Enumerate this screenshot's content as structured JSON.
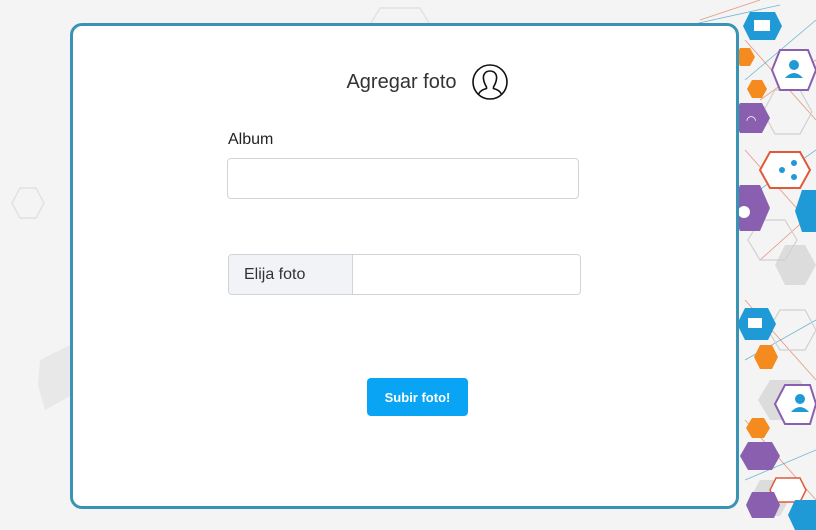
{
  "form": {
    "title": "Agregar foto",
    "album_label": "Album",
    "album_value": "",
    "file_button_label": "Elija foto",
    "file_name": "",
    "submit_label": "Subir foto!"
  },
  "icons": {
    "title_icon": "user-profile-icon"
  },
  "colors": {
    "card_border": "#3b93b3",
    "submit_button": "#0aa4f4",
    "file_button_bg": "#f1f3f6"
  }
}
